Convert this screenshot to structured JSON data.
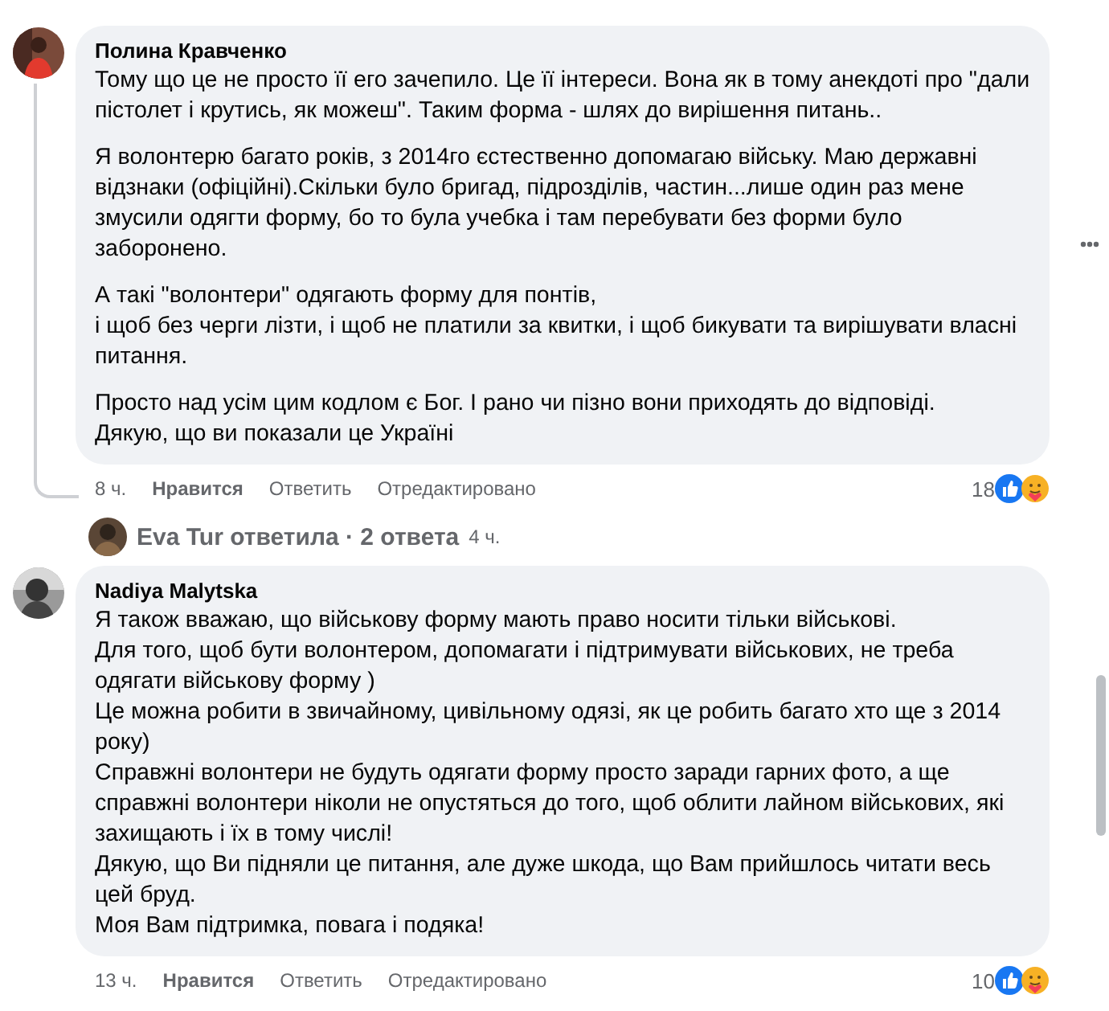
{
  "comments": [
    {
      "author": "Полина Кравченко",
      "avatar": {
        "kind": "picture"
      },
      "paragraphs": [
        {
          "lines": [
            "Тому що це не просто її его зачепило. Це її інтереси. Вона як в тому анекдоті про \"дали пістолет і крутись, як можеш\". Таким форма - шлях до вирішення питань.."
          ]
        },
        {
          "lines": [
            "Я волонтерю багато років, з 2014го єстественно допомагаю війську. Маю державні відзнаки (офіційні).Скільки було бригад, підрозділів, частин...лише один раз мене змусили одягти форму, бо то була учебка і там перебувати без форми було заборонено."
          ]
        },
        {
          "lines": [
            "А такі \"волонтери\" одягають форму для понтів,",
            "і щоб без черги лізти, і щоб не платили за квитки, і щоб бикувати та вирішувати власні питання."
          ]
        },
        {
          "lines": [
            "Просто над усім цим кодлом є Бог. І рано чи пізно вони приходять до відповіді.",
            "Дякую, що ви показали це Україні"
          ]
        }
      ],
      "time": "8 ч.",
      "like": "Нравится",
      "reply": "Ответить",
      "edited": "Отредактировано",
      "reactions_count": "18",
      "has_menu": true,
      "replies_summary": {
        "text": "Eva Tur ответила · 2 ответа",
        "time": "4 ч."
      }
    },
    {
      "author": "Nadiya Malytska",
      "avatar": {
        "kind": "picture"
      },
      "paragraphs": [
        {
          "lines": [
            "Я також вважаю, що військову форму мають право носити тільки військові.",
            "Для того, щоб бути волонтером, допомагати і підтримувати військових, не треба одягати військову форму )",
            "Це можна робити в звичайному, цивільному одязі, як це робить багато хто ще з 2014 року)",
            "Справжні волонтери не будуть одягати форму просто заради гарних фото, а ще справжні волонтери ніколи не опустяться до того, щоб облити лайном військових, які захищають і їх в тому числі!",
            "Дякую, що Ви підняли це питання, але дуже шкода, що Вам прийшлось читати весь цей бруд.",
            "Моя Вам підтримка, повага і подяка!"
          ]
        }
      ],
      "time": "13 ч.",
      "like": "Нравится",
      "reply": "Ответить",
      "edited": "Отредактировано",
      "reactions_count": "10"
    }
  ]
}
